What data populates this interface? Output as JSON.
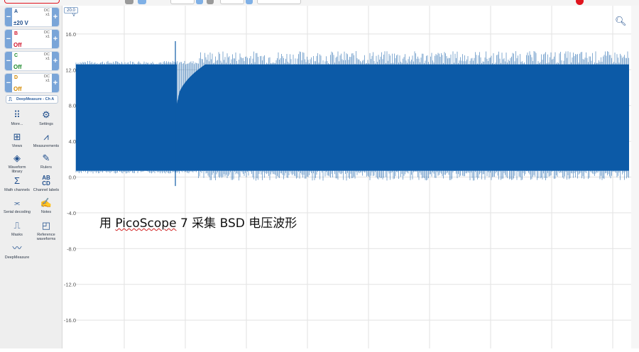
{
  "channels": [
    {
      "name": "A",
      "coupling": "DC",
      "probe": "x1",
      "value": "±20 V",
      "color": "#1f4e8c"
    },
    {
      "name": "B",
      "coupling": "DC",
      "probe": "x1",
      "value": "Off",
      "color": "#d0142c"
    },
    {
      "name": "C",
      "coupling": "DC",
      "probe": "x1",
      "value": "Off",
      "color": "#1c8a2c"
    },
    {
      "name": "D",
      "coupling": "DC",
      "probe": "x1",
      "value": "Off",
      "color": "#d48a00"
    }
  ],
  "deepmeasure_button": "DeepMeasure - Ch A",
  "tools": [
    {
      "label": "More...",
      "icon": "grid-icon"
    },
    {
      "label": "Settings",
      "icon": "gear-icon"
    },
    {
      "label": "Views",
      "icon": "views-icon"
    },
    {
      "label": "Measurements",
      "icon": "measurements-icon"
    },
    {
      "label": "Waveform library",
      "icon": "waveform-library-icon"
    },
    {
      "label": "Rulers",
      "icon": "rulers-icon"
    },
    {
      "label": "Math channels",
      "icon": "sigma-icon"
    },
    {
      "label": "Channel labels",
      "icon": "channel-labels-icon"
    },
    {
      "label": "Serial decoding",
      "icon": "serial-decoding-icon"
    },
    {
      "label": "Notes",
      "icon": "notes-icon"
    },
    {
      "label": "Masks",
      "icon": "masks-icon"
    },
    {
      "label": "Reference waveforms",
      "icon": "reference-waveforms-icon"
    },
    {
      "label": "DeepMeasure",
      "icon": "deepmeasure-icon"
    }
  ],
  "plot": {
    "range_label": "20.0",
    "unit_label": "V",
    "y_ticks": [
      "16.0",
      "12.0",
      "8.0",
      "4.0",
      "0.0",
      "-4.0",
      "-8.0",
      "-12.0",
      "-16.0"
    ],
    "waveform_color": "#0d5aa7"
  },
  "caption": {
    "prefix": "用 ",
    "brand": "PicoScope",
    "suffix": " 7 采集 BSD 电压波形"
  }
}
